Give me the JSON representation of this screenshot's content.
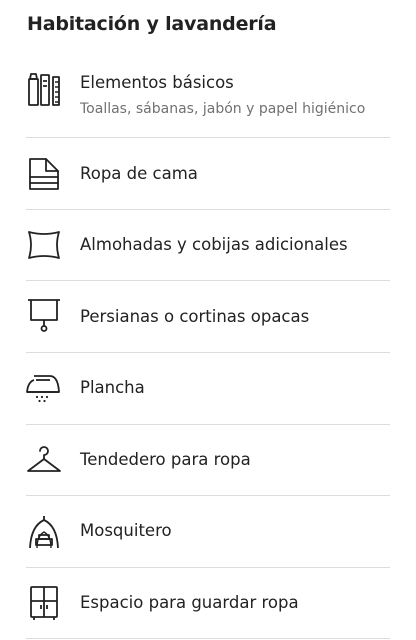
{
  "section": {
    "title": "Habitación y lavandería"
  },
  "amenities": [
    {
      "label": "Elementos básicos",
      "sublabel": "Toallas, sábanas, jabón y papel higiénico",
      "icon": "toiletries-icon"
    },
    {
      "label": "Ropa de cama",
      "icon": "bed-linens-icon"
    },
    {
      "label": "Almohadas y cobijas adicionales",
      "icon": "pillow-icon"
    },
    {
      "label": "Persianas o cortinas opacas",
      "icon": "blinds-icon"
    },
    {
      "label": "Plancha",
      "icon": "iron-icon"
    },
    {
      "label": "Tendedero para ropa",
      "icon": "hanger-icon"
    },
    {
      "label": "Mosquitero",
      "icon": "mosquito-net-icon"
    },
    {
      "label": "Espacio para guardar ropa",
      "icon": "wardrobe-icon"
    }
  ],
  "colors": {
    "text": "#222222",
    "secondary_text": "#717171",
    "divider": "#dddddd"
  }
}
